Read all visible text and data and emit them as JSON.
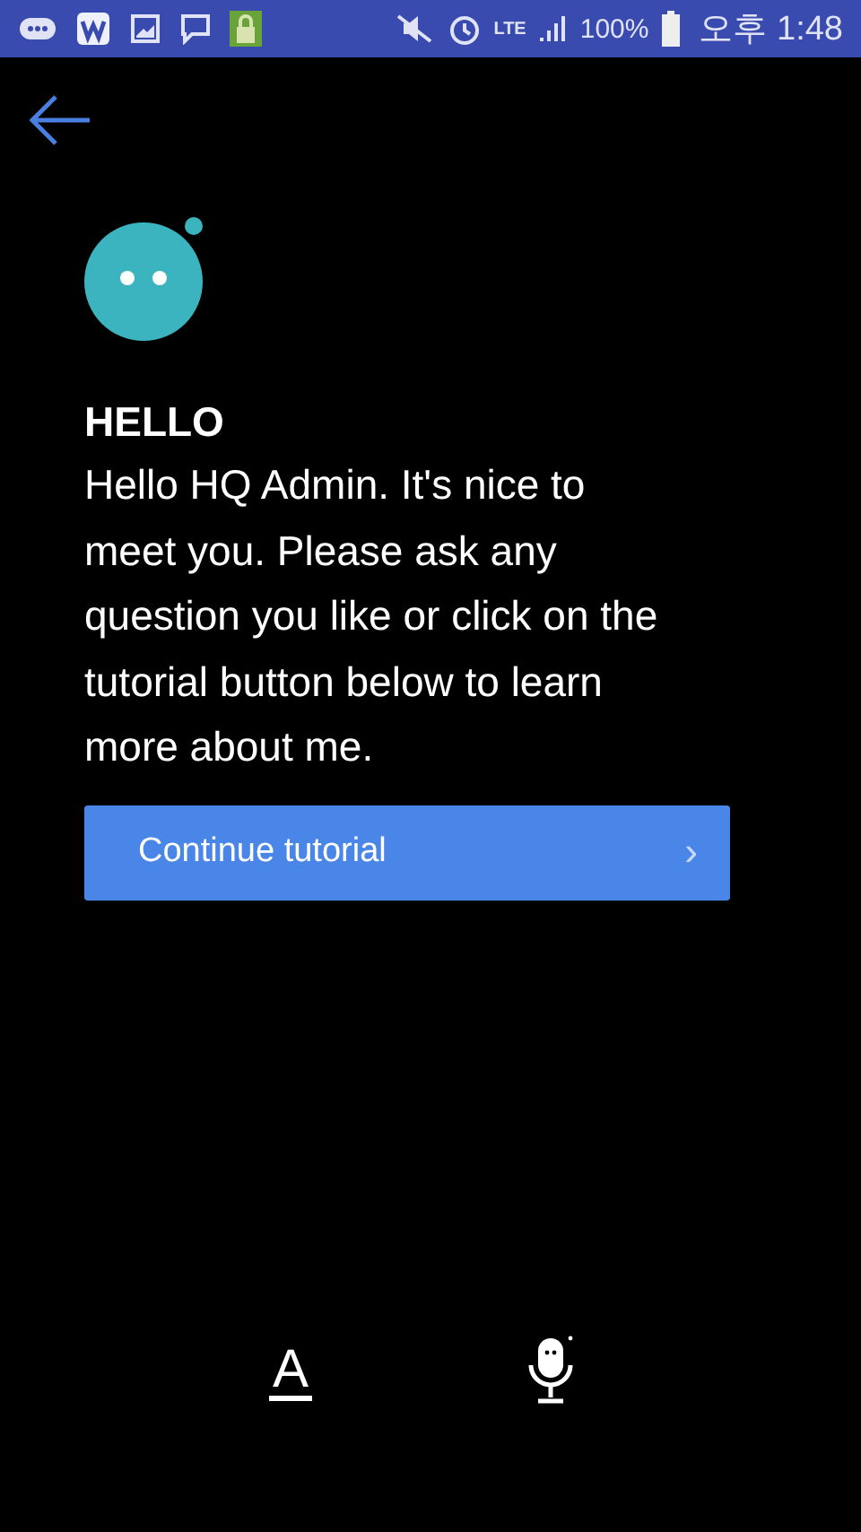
{
  "status_bar": {
    "battery": "100%",
    "time": "오후 1:48",
    "network": "LTE"
  },
  "greeting": {
    "title": "HELLO",
    "message": "Hello HQ Admin. It's nice to meet you. Please ask any question you like or click on the tutorial button below to learn more about me."
  },
  "tutorial_button": {
    "label": "Continue tutorial",
    "chevron": "›"
  },
  "bottom_bar": {
    "text_mode": "A"
  }
}
